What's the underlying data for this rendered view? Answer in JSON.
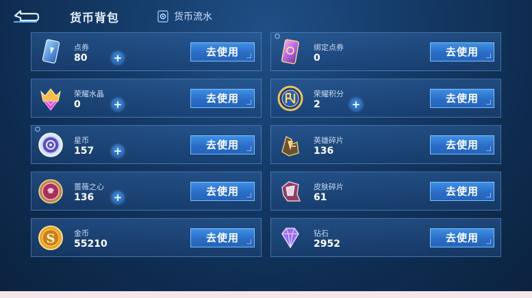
{
  "header": {
    "title": "货币背包",
    "flow_label": "货币流水"
  },
  "colors": {
    "accent": "#2a6dc6",
    "card_border": "#78aae6",
    "background": "#143a66"
  },
  "currencies": [
    {
      "name": "点券",
      "amount": "80",
      "icon": "coupon-icon",
      "has_plus": true,
      "button": "去使用"
    },
    {
      "name": "绑定点券",
      "amount": "0",
      "icon": "bound-coupon-icon",
      "has_plus": false,
      "button": "去使用"
    },
    {
      "name": "荣耀水晶",
      "amount": "0",
      "icon": "glory-crystal-icon",
      "has_plus": true,
      "button": "去使用"
    },
    {
      "name": "荣耀积分",
      "amount": "2",
      "icon": "glory-points-icon",
      "has_plus": true,
      "button": "去使用"
    },
    {
      "name": "星币",
      "amount": "157",
      "icon": "star-coin-icon",
      "has_plus": true,
      "button": "去使用"
    },
    {
      "name": "英雄碎片",
      "amount": "136",
      "icon": "hero-fragment-icon",
      "has_plus": false,
      "button": "去使用"
    },
    {
      "name": "蔷薇之心",
      "amount": "136",
      "icon": "rose-heart-icon",
      "has_plus": true,
      "button": "去使用"
    },
    {
      "name": "皮肤碎片",
      "amount": "61",
      "icon": "skin-fragment-icon",
      "has_plus": false,
      "button": "去使用"
    },
    {
      "name": "金币",
      "amount": "55210",
      "icon": "gold-coin-icon",
      "has_plus": false,
      "button": "去使用"
    },
    {
      "name": "钻石",
      "amount": "2952",
      "icon": "diamond-icon",
      "has_plus": false,
      "button": "去使用"
    }
  ]
}
